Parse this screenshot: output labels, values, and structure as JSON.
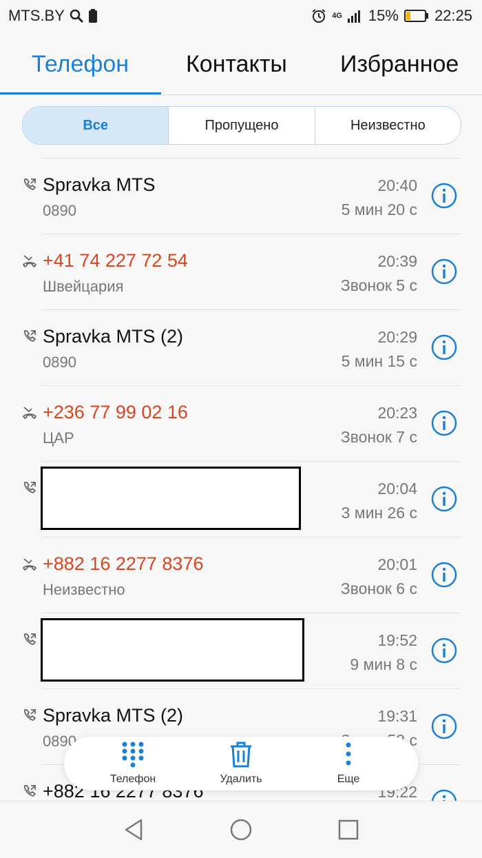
{
  "status_bar": {
    "carrier": "MTS.BY",
    "network": "4G",
    "battery": "15%",
    "time": "22:25"
  },
  "tabs": [
    {
      "label": "Телефон",
      "active": true
    },
    {
      "label": "Контакты",
      "active": false
    },
    {
      "label": "Избранное",
      "active": false
    }
  ],
  "filters": [
    {
      "label": "Все",
      "selected": true
    },
    {
      "label": "Пропущено",
      "selected": false
    },
    {
      "label": "Неизвестно",
      "selected": false
    }
  ],
  "calls": [
    {
      "name": "Spravka MTS",
      "sub": "0890",
      "time": "20:40",
      "detail": "5 мин 20 с",
      "type": "outgoing",
      "missed": false,
      "redacted": false
    },
    {
      "name": "+41 74 227 72 54",
      "sub": "Швейцария",
      "time": "20:39",
      "detail": "Звонок 5 с",
      "type": "missed",
      "missed": true,
      "redacted": false
    },
    {
      "name": "Spravka MTS (2)",
      "sub": "0890",
      "time": "20:29",
      "detail": "5 мин 15 с",
      "type": "outgoing",
      "missed": false,
      "redacted": false
    },
    {
      "name": "+236 77 99 02 16",
      "sub": "ЦАР",
      "time": "20:23",
      "detail": "Звонок 7 с",
      "type": "missed",
      "missed": true,
      "redacted": false
    },
    {
      "name": "",
      "sub": "",
      "time": "20:04",
      "detail": "3 мин 26 с",
      "type": "outgoing",
      "missed": false,
      "redacted": true
    },
    {
      "name": "+882 16 2277 8376",
      "sub": "Неизвестно",
      "time": "20:01",
      "detail": "Звонок 6 с",
      "type": "missed",
      "missed": true,
      "redacted": false
    },
    {
      "name": "",
      "sub": "",
      "time": "19:52",
      "detail": "9 мин 8 с",
      "type": "outgoing",
      "missed": false,
      "redacted": true
    },
    {
      "name": "Spravka MTS (2)",
      "sub": "0890",
      "time": "19:31",
      "detail": "3 мин 52 с",
      "type": "outgoing",
      "missed": false,
      "redacted": false
    },
    {
      "name": "+882 16 2277 8376",
      "sub": "",
      "time": "19:22",
      "detail": "",
      "type": "outgoing",
      "missed": false,
      "redacted": false
    }
  ],
  "bottom_actions": [
    {
      "label": "Телефон",
      "icon": "dialpad-icon"
    },
    {
      "label": "Удалить",
      "icon": "trash-icon"
    },
    {
      "label": "Еще",
      "icon": "more-vertical-icon"
    }
  ],
  "colors": {
    "accent": "#1a7fd6",
    "missed": "#d9461e"
  }
}
